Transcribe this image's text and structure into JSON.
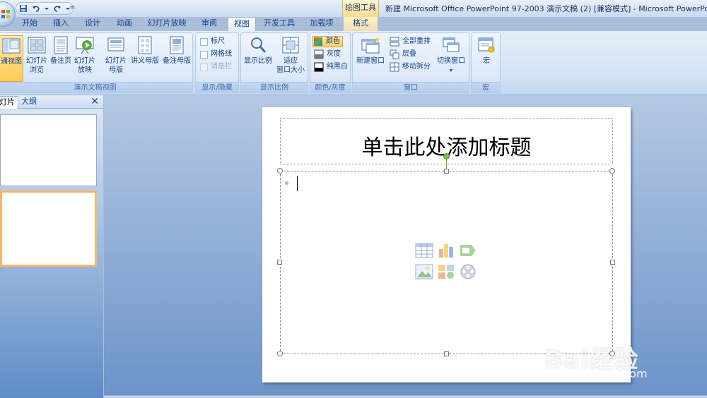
{
  "title_bar": {
    "context_tool_group": "绘图工具",
    "window_title": "新建 Microsoft Office PowerPoint 97-2003 演示文稿 (2) [兼容模式] - Microsoft PowerPoint",
    "qat_separator": "="
  },
  "tabs": [
    {
      "label": "开始"
    },
    {
      "label": "插入"
    },
    {
      "label": "设计"
    },
    {
      "label": "动画"
    },
    {
      "label": "幻灯片放映"
    },
    {
      "label": "审阅"
    },
    {
      "label": "视图",
      "active": true
    },
    {
      "label": "开发工具"
    },
    {
      "label": "加载项"
    },
    {
      "label": "格式"
    }
  ],
  "ribbon": {
    "presentation_views": {
      "label": "演示文稿视图",
      "normal": "通视图",
      "slide_sorter_1": "幻灯片",
      "slide_sorter_2": "浏览",
      "notes_page": "备注页",
      "slideshow_1": "幻灯片",
      "slideshow_2": "放映",
      "slide_master_1": "幻灯片",
      "slide_master_2": "母版",
      "handout_master": "讲义母版",
      "notes_master": "备注母版"
    },
    "show_hide": {
      "label": "显示/隐藏",
      "ruler": "标尺",
      "gridlines": "网格线",
      "message_bar": "消息栏"
    },
    "zoom": {
      "label": "显示比例",
      "zoom": "显示比例",
      "fit_1": "适应",
      "fit_2": "窗口大小"
    },
    "color": {
      "label": "颜色/灰度",
      "color": "颜色",
      "grayscale": "灰度",
      "pure_bw": "纯黑白"
    },
    "window": {
      "label": "窗口",
      "new_window": "新建窗口",
      "arrange_all": "全部重排",
      "cascade": "层叠",
      "move_split": "移动拆分",
      "switch_windows": "切换窗口"
    },
    "macros": {
      "label": "宏",
      "macros": "宏"
    }
  },
  "left_pane": {
    "tab_slides": "灯片",
    "tab_outline": "大纲",
    "close": "✕"
  },
  "slide": {
    "title_placeholder": "单击此处添加标题"
  },
  "watermark": {
    "brand": "Bai经验",
    "url": "jingyan.baidu.com"
  }
}
